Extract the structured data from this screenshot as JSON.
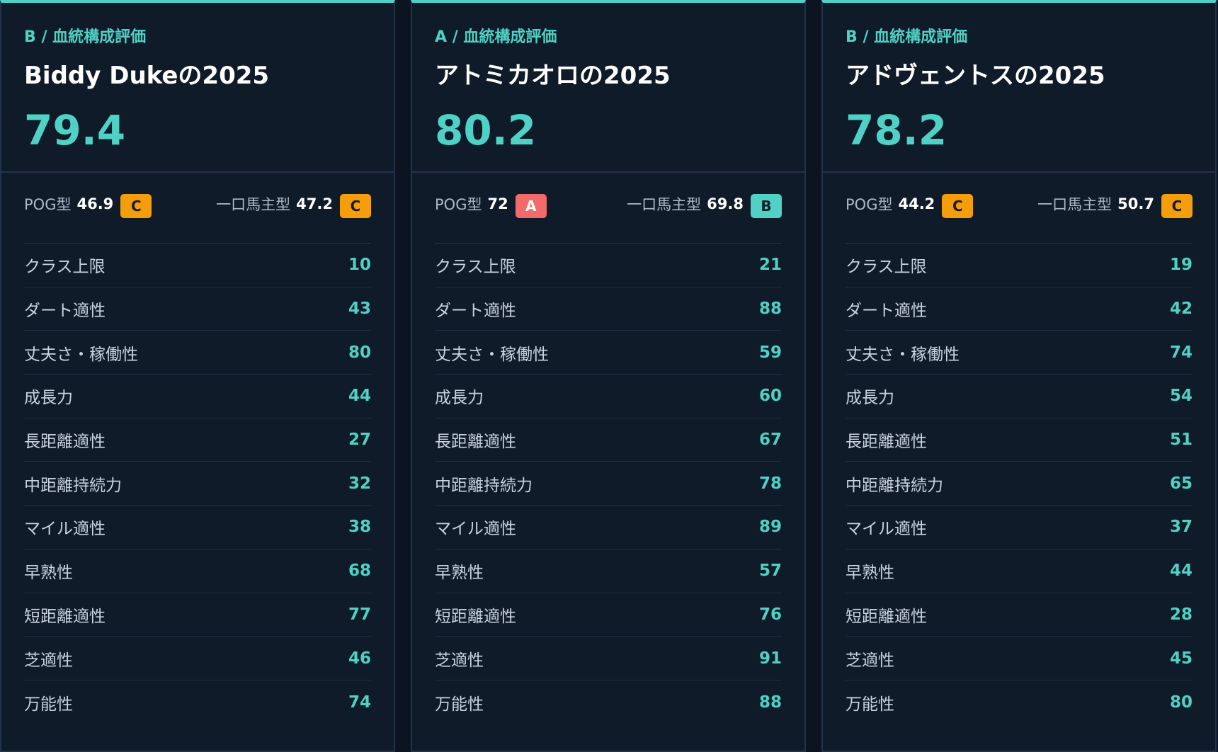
{
  "cards": [
    {
      "grade": "B",
      "eval_label": "血統構成評価",
      "title": "Biddy Dukeの2025",
      "score": "79.4",
      "pog_label": "POG型",
      "pog_value": "46.9",
      "pog_grade": "C",
      "owner_label": "一口馬主型",
      "owner_value": "47.2",
      "owner_grade": "C",
      "stats": [
        {
          "label": "クラス上限",
          "value": "10"
        },
        {
          "label": "ダート適性",
          "value": "43"
        },
        {
          "label": "丈夫さ・稼働性",
          "value": "80"
        },
        {
          "label": "成長力",
          "value": "44"
        },
        {
          "label": "長距離適性",
          "value": "27"
        },
        {
          "label": "中距離持続力",
          "value": "32"
        },
        {
          "label": "マイル適性",
          "value": "38"
        },
        {
          "label": "早熟性",
          "value": "68"
        },
        {
          "label": "短距離適性",
          "value": "77"
        },
        {
          "label": "芝適性",
          "value": "46"
        },
        {
          "label": "万能性",
          "value": "74"
        }
      ]
    },
    {
      "grade": "A",
      "eval_label": "血統構成評価",
      "title": "アトミカオロの2025",
      "score": "80.2",
      "pog_label": "POG型",
      "pog_value": "72",
      "pog_grade": "A",
      "owner_label": "一口馬主型",
      "owner_value": "69.8",
      "owner_grade": "B",
      "stats": [
        {
          "label": "クラス上限",
          "value": "21"
        },
        {
          "label": "ダート適性",
          "value": "88"
        },
        {
          "label": "丈夫さ・稼働性",
          "value": "59"
        },
        {
          "label": "成長力",
          "value": "60"
        },
        {
          "label": "長距離適性",
          "value": "67"
        },
        {
          "label": "中距離持続力",
          "value": "78"
        },
        {
          "label": "マイル適性",
          "value": "89"
        },
        {
          "label": "早熟性",
          "value": "57"
        },
        {
          "label": "短距離適性",
          "value": "76"
        },
        {
          "label": "芝適性",
          "value": "91"
        },
        {
          "label": "万能性",
          "value": "88"
        }
      ]
    },
    {
      "grade": "B",
      "eval_label": "血統構成評価",
      "title": "アドヴェントスの2025",
      "score": "78.2",
      "pog_label": "POG型",
      "pog_value": "44.2",
      "pog_grade": "C",
      "owner_label": "一口馬主型",
      "owner_value": "50.7",
      "owner_grade": "C",
      "stats": [
        {
          "label": "クラス上限",
          "value": "19"
        },
        {
          "label": "ダート適性",
          "value": "42"
        },
        {
          "label": "丈夫さ・稼働性",
          "value": "74"
        },
        {
          "label": "成長力",
          "value": "54"
        },
        {
          "label": "長距離適性",
          "value": "51"
        },
        {
          "label": "中距離持続力",
          "value": "65"
        },
        {
          "label": "マイル適性",
          "value": "37"
        },
        {
          "label": "早熟性",
          "value": "44"
        },
        {
          "label": "短距離適性",
          "value": "28"
        },
        {
          "label": "芝適性",
          "value": "45"
        },
        {
          "label": "万能性",
          "value": "80"
        }
      ]
    }
  ]
}
